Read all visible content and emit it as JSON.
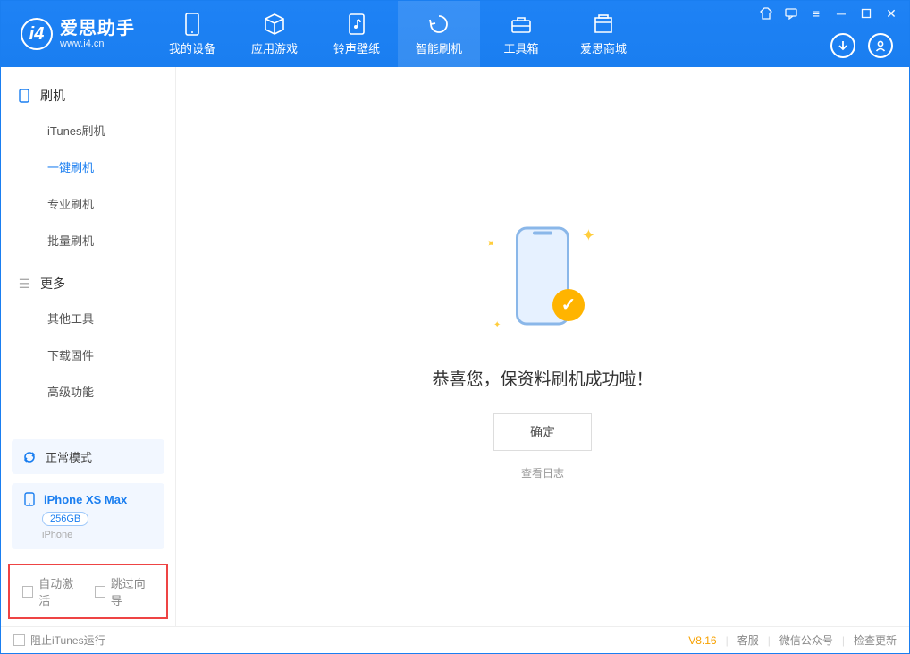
{
  "app": {
    "name": "爱思助手",
    "url": "www.i4.cn"
  },
  "tabs": {
    "device": "我的设备",
    "apps": "应用游戏",
    "ringtones": "铃声壁纸",
    "flash": "智能刷机",
    "toolbox": "工具箱",
    "store": "爱思商城"
  },
  "sidebar": {
    "groupFlash": "刷机",
    "items": {
      "itunes": "iTunes刷机",
      "oneclick": "一键刷机",
      "pro": "专业刷机",
      "batch": "批量刷机"
    },
    "groupMore": "更多",
    "more": {
      "other": "其他工具",
      "firmware": "下载固件",
      "advanced": "高级功能"
    }
  },
  "device": {
    "mode": "正常模式",
    "name": "iPhone XS Max",
    "storage": "256GB",
    "type": "iPhone"
  },
  "options": {
    "autoActivate": "自动激活",
    "skipGuide": "跳过向导"
  },
  "main": {
    "success": "恭喜您，保资料刷机成功啦！",
    "ok": "确定",
    "viewLog": "查看日志"
  },
  "status": {
    "blockItunes": "阻止iTunes运行",
    "version": "V8.16",
    "support": "客服",
    "wechat": "微信公众号",
    "update": "检查更新"
  }
}
